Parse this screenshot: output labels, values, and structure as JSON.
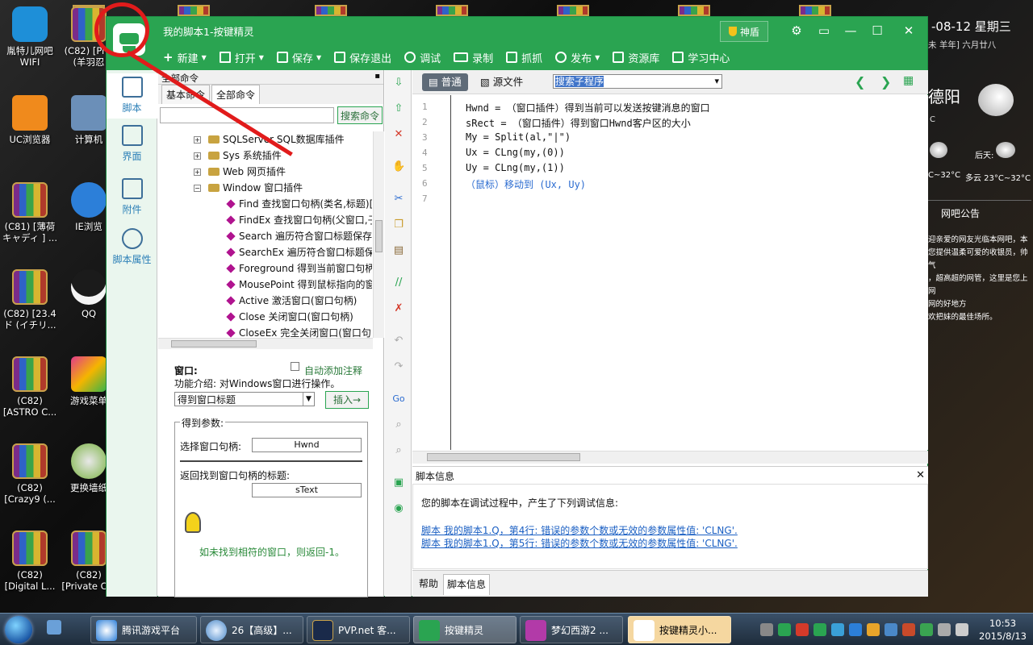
{
  "desktop": {
    "icons": [
      {
        "label": "胤特儿网吧WIFI"
      },
      {
        "label": "(C82) [Pi K (羊羽忍"
      },
      {
        "label": "UC浏览器"
      },
      {
        "label": "计算机"
      },
      {
        "label": "(C81) [薄荷キャディ ] ..."
      },
      {
        "label": "IE浏览"
      },
      {
        "label": "(C82) [23.4 ド (イチリ..."
      },
      {
        "label": "QQ"
      },
      {
        "label": "(C82) [ASTRO C..."
      },
      {
        "label": "游戏菜单"
      },
      {
        "label": "(C82) [Crazy9 (..."
      },
      {
        "label": "更换墙纸"
      },
      {
        "label": "(C82) [Digital L..."
      },
      {
        "label": "(C82) [Private C..."
      }
    ],
    "widget": {
      "date": "-08-12 星期三",
      "lunar": "未 羊年] 六月廿八",
      "city": "德阳",
      "unit": "C",
      "temp_today": "C~32°C",
      "day_after_label": "后天:",
      "day_after": "多云 23°C~32°C",
      "notice_title": "网吧公告",
      "notice_lines": [
        "迎亲爱的网友光临本网吧，本",
        "您提供温柔可爱的收银员，帅气",
        "，超高超的网管，这里是您上网",
        "网的好地方",
        "欢把妹的最佳场所。"
      ]
    }
  },
  "window": {
    "title": "我的脚本1-按键精灵",
    "shield_label": "神盾",
    "toolbar": [
      {
        "label": "新建",
        "icon": "plus-icon",
        "caret": true
      },
      {
        "label": "打开",
        "icon": "folder-icon",
        "caret": true
      },
      {
        "label": "保存",
        "icon": "save-icon",
        "caret": true
      },
      {
        "label": "保存退出",
        "icon": "save-exit-icon",
        "caret": false
      },
      {
        "label": "调试",
        "icon": "play-icon",
        "caret": false
      },
      {
        "label": "录制",
        "icon": "camera-icon",
        "caret": false
      },
      {
        "label": "抓抓",
        "icon": "capture-icon",
        "caret": false
      },
      {
        "label": "发布",
        "icon": "publish-icon",
        "caret": true
      },
      {
        "label": "资源库",
        "icon": "library-icon",
        "caret": false
      },
      {
        "label": "学习中心",
        "icon": "learn-icon",
        "caret": false
      }
    ],
    "leftnav": [
      {
        "label": "脚本",
        "icon": "script-icon"
      },
      {
        "label": "界面",
        "icon": "ui-icon"
      },
      {
        "label": "附件",
        "icon": "attachment-icon"
      },
      {
        "label": "脚本属性",
        "icon": "info-icon"
      }
    ],
    "cmdpanel": {
      "header": "全部命令",
      "pin": "ᵖ",
      "tabs": [
        "基本命令",
        "全部命令"
      ],
      "search_button": "搜索命令",
      "tree": [
        {
          "label": "SQLServer SQL数据库插件",
          "level": 1,
          "type": "folder",
          "exp": "+"
        },
        {
          "label": "Sys 系统插件",
          "level": 1,
          "type": "folder",
          "exp": "+"
        },
        {
          "label": "Web 网页插件",
          "level": 1,
          "type": "folder",
          "exp": "+"
        },
        {
          "label": "Window 窗口插件",
          "level": 1,
          "type": "folder",
          "exp": "−"
        },
        {
          "label": "Find 查找窗口句柄(类名,标题)[",
          "level": 2,
          "type": "cmd"
        },
        {
          "label": "FindEx 查找窗口句柄(父窗口,子",
          "level": 2,
          "type": "cmd"
        },
        {
          "label": "Search 遍历符合窗口标题保存",
          "level": 2,
          "type": "cmd"
        },
        {
          "label": "SearchEx 遍历符合窗口标题保",
          "level": 2,
          "type": "cmd"
        },
        {
          "label": "Foreground 得到当前窗口句柄",
          "level": 2,
          "type": "cmd"
        },
        {
          "label": "MousePoint 得到鼠标指向的窗",
          "level": 2,
          "type": "cmd"
        },
        {
          "label": "Active 激活窗口(窗口句柄)",
          "level": 2,
          "type": "cmd"
        },
        {
          "label": "Close 关闭窗口(窗口句柄)",
          "level": 2,
          "type": "cmd"
        },
        {
          "label": "CloseEx 完全关闭窗口(窗口句",
          "level": 2,
          "type": "cmd"
        }
      ],
      "detail": {
        "title": "窗口:",
        "auto_comment": "自动添加注释",
        "intro": "功能介绍: 对Windows窗口进行操作。",
        "select_value": "得到窗口标题",
        "insert_button": "插入→",
        "group_title": "得到参数:",
        "param1_label": "选择窗口句柄:",
        "param1_value": "Hwnd",
        "param2_label": "返回找到窗口句柄的标题:",
        "param2_value": "sText",
        "note": "如未找到相符的窗口，则返回-1。"
      }
    },
    "editor": {
      "mode_normal": "普通",
      "mode_source": "源文件",
      "sub_search": "搜索子程序",
      "lines": [
        {
          "n": "1",
          "text": "Hwnd = （窗口插件）得到当前可以发送按键消息的窗口",
          "style": "normal"
        },
        {
          "n": "2",
          "text": "sRect = （窗口插件）得到窗口Hwnd客户区的大小",
          "style": "normal"
        },
        {
          "n": "3",
          "text": "My = Split(al,\"|\")",
          "style": "normal"
        },
        {
          "n": "4",
          "text": "Ux = CLng(my,(0))",
          "style": "normal"
        },
        {
          "n": "5",
          "text": "Uy = CLng(my,(1))",
          "style": "normal"
        },
        {
          "n": "6",
          "text": "（鼠标）移动到 (Ux, Uy)",
          "style": "blue"
        },
        {
          "n": "7",
          "text": "",
          "style": "normal"
        }
      ]
    },
    "info": {
      "title": "脚本信息",
      "message": "您的脚本在调试过程中，产生了下列调试信息:",
      "errors": [
        "脚本 我的脚本1.Q，第4行: 错误的参数个数或无效的参数属性值: 'CLNG'.",
        "脚本 我的脚本1.Q，第5行: 错误的参数个数或无效的参数属性值: 'CLNG'."
      ],
      "tabs": [
        "帮助",
        "脚本信息"
      ]
    }
  },
  "taskbar": {
    "tasks": [
      {
        "label": "腾讯游戏平台"
      },
      {
        "label": "26【高级】..."
      },
      {
        "label": "PVP.net 客..."
      },
      {
        "label": "按键精灵"
      },
      {
        "label": "梦幻西游2 ..."
      },
      {
        "label": "按键精灵小..."
      }
    ],
    "time": "10:53",
    "date": "2015/8/13"
  },
  "colors": {
    "accent": "#2aa451",
    "annotation": "#e11b1b",
    "link": "#1a5fc3"
  }
}
